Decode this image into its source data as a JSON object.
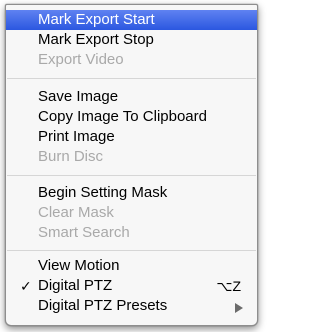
{
  "menu": {
    "items": [
      {
        "label": "Mark Export Start",
        "state": "highlighted"
      },
      {
        "label": "Mark Export Stop",
        "state": "enabled"
      },
      {
        "label": "Export Video",
        "state": "disabled"
      },
      {
        "label": "Save Image",
        "state": "enabled"
      },
      {
        "label": "Copy Image To Clipboard",
        "state": "enabled"
      },
      {
        "label": "Print Image",
        "state": "enabled"
      },
      {
        "label": "Burn Disc",
        "state": "disabled"
      },
      {
        "label": "Begin Setting Mask",
        "state": "enabled"
      },
      {
        "label": "Clear Mask",
        "state": "disabled"
      },
      {
        "label": "Smart Search",
        "state": "disabled"
      },
      {
        "label": "View Motion",
        "state": "enabled"
      },
      {
        "label": "Digital PTZ",
        "state": "enabled",
        "checked": true,
        "checkmark": "✓",
        "shortcut": "⌥Z"
      },
      {
        "label": "Digital PTZ Presets",
        "state": "enabled",
        "submenu": true,
        "icon": "triangle-right-icon"
      }
    ]
  },
  "colors": {
    "highlight": "#3a6ae8",
    "disabled_text": "#a9a9a9",
    "background": "#f7f7f7",
    "separator": "#d6d6d6"
  }
}
